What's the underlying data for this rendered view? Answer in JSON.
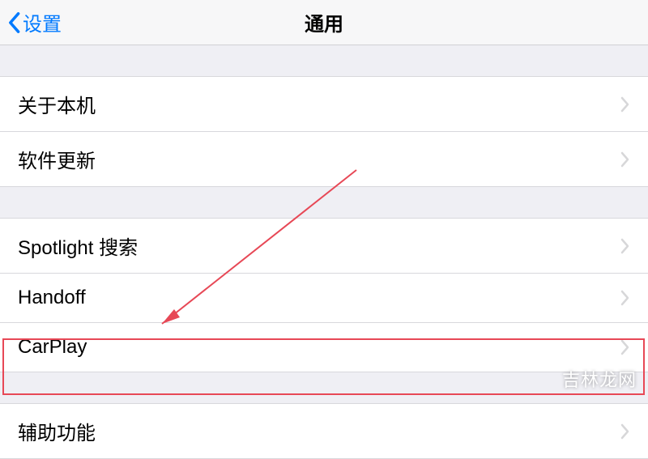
{
  "nav": {
    "back_label": "设置",
    "title": "通用"
  },
  "section1": {
    "items": [
      {
        "label": "关于本机"
      },
      {
        "label": "软件更新"
      }
    ]
  },
  "section2": {
    "items": [
      {
        "label": "Spotlight 搜索"
      },
      {
        "label": "Handoff"
      },
      {
        "label": "CarPlay"
      }
    ]
  },
  "section3": {
    "items": [
      {
        "label": "辅助功能"
      }
    ]
  },
  "watermark": "吉林龙网"
}
